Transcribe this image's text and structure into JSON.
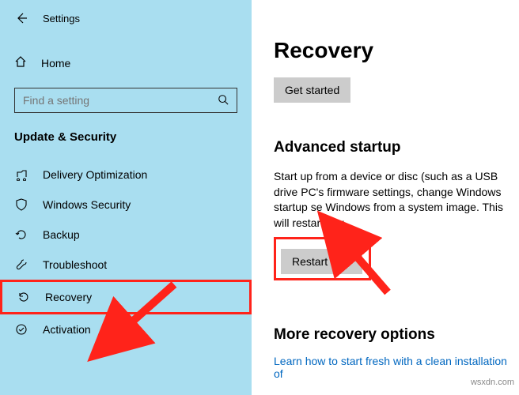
{
  "header": {
    "title": "Settings"
  },
  "sidebar": {
    "home_label": "Home",
    "search_placeholder": "Find a setting",
    "section_label": "Update & Security",
    "items": [
      {
        "label": "Delivery Optimization"
      },
      {
        "label": "Windows Security"
      },
      {
        "label": "Backup"
      },
      {
        "label": "Troubleshoot"
      },
      {
        "label": "Recovery"
      },
      {
        "label": "Activation"
      }
    ]
  },
  "main": {
    "page_title": "Recovery",
    "get_started_label": "Get started",
    "advanced_startup_heading": "Advanced startup",
    "advanced_startup_body": "Start up from a device or disc (such as a USB drive PC's firmware settings, change Windows startup se Windows from a system image. This will restart you",
    "restart_label": "Restart now",
    "more_options_heading": "More recovery options",
    "fresh_start_link": "Learn how to start fresh with a clean installation of"
  },
  "watermark": "wsxdn.com"
}
